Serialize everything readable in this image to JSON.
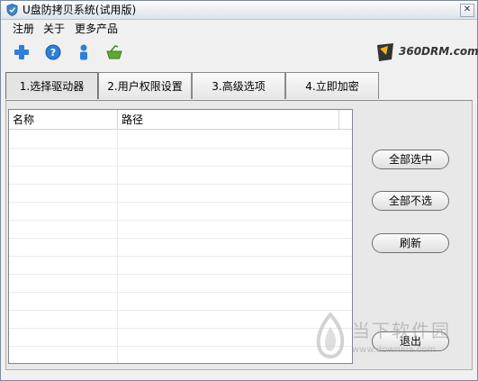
{
  "window": {
    "title": "U盘防拷贝系统(试用版)"
  },
  "menu": {
    "items": [
      "注册",
      "关于",
      "更多产品"
    ]
  },
  "toolbar": {
    "icons": [
      "add-icon",
      "help-icon",
      "user-icon",
      "basket-icon"
    ]
  },
  "logo": {
    "text": "360DRM.com"
  },
  "tabs": [
    {
      "label": "1.选择驱动器",
      "active": true
    },
    {
      "label": "2.用户权限设置",
      "active": false
    },
    {
      "label": "3.高级选项",
      "active": false
    },
    {
      "label": "4.立即加密",
      "active": false
    }
  ],
  "list": {
    "columns": [
      "名称",
      "路径"
    ],
    "rows": []
  },
  "buttons": {
    "select_all": "全部选中",
    "select_none": "全部不选",
    "refresh": "刷新",
    "exit": "退出"
  },
  "watermark": {
    "text": "当下软件园",
    "url": "www.downxia.com"
  }
}
